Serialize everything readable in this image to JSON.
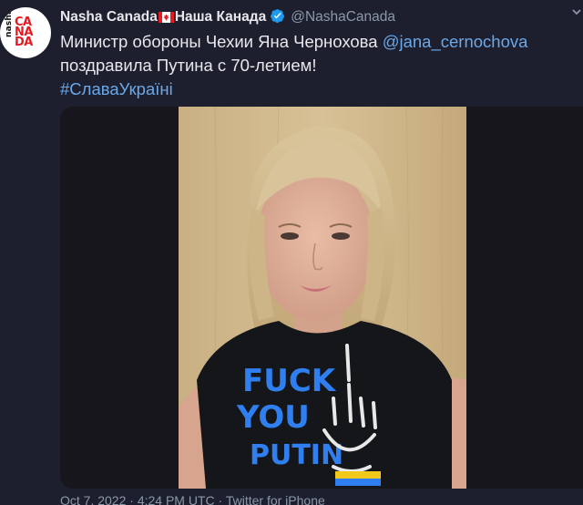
{
  "author": {
    "display_name_latin": "Nasha Canada",
    "display_name_cyrillic": "Наша Канада",
    "handle": "@NashaCanada",
    "avatar_text_top": "nasha",
    "avatar_text_main": "CANADA"
  },
  "tweet": {
    "text_line1_prefix": "Министр обороны Чехии Яна Чернохова ",
    "mention": "@jana_cernochova",
    "text_line2": "поздравила Путина с 70-летием!",
    "hashtag": "#СлаваУкраїні"
  },
  "photo": {
    "shirt_text_line1": "FUCK",
    "shirt_text_line2": "YOU",
    "shirt_text_line3": "PUTIN"
  },
  "meta": {
    "timestamp": "Oct 7, 2022 · 4:24 PM UTC",
    "separator": " · ",
    "source": "Twitter for iPhone"
  },
  "colors": {
    "background": "#1e1f2e",
    "link": "#6aa8e8",
    "muted": "#8b98a5",
    "verified": "#1d9bf0"
  },
  "icons": {
    "flag": "canada-flag-icon",
    "verified": "verified-badge-icon",
    "more": "more-icon"
  }
}
